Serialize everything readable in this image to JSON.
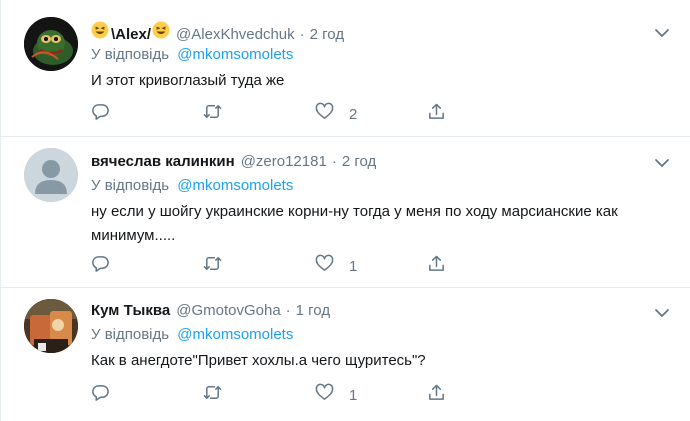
{
  "tweets": [
    {
      "name": "\\Alex/",
      "handle": "@AlexKhvedchuk",
      "dot": "·",
      "time": "2 год",
      "reply_prefix": "У відповідь",
      "reply_mention": "@mkomsomolets",
      "text": "И этот кривоглазый туда же",
      "like_count": "2"
    },
    {
      "name": "вячеслав калинкин",
      "handle": "@zero12181",
      "dot": "·",
      "time": "2 год",
      "reply_prefix": "У відповідь",
      "reply_mention": "@mkomsomolets",
      "text": "ну если у шойгу украинские корни-ну тогда у меня по ходу марсианские как минимум.....",
      "like_count": "1"
    },
    {
      "name": "Кум Тыква",
      "handle": "@GmotovGoha",
      "dot": "·",
      "time": "1 год",
      "reply_prefix": "У відповідь",
      "reply_mention": "@mkomsomolets",
      "text": "Как в анегдоте\"Привет хохлы.а чего щуритесь\"?",
      "like_count": "1"
    }
  ],
  "icons": {
    "reply": "reply-icon",
    "retweet": "retweet-icon",
    "like": "like-icon",
    "share": "share-icon",
    "more": "chevron-down-icon",
    "emoji": "grinning-squinting-face-emoji"
  },
  "colors": {
    "accent": "#1da1f2",
    "secondary_text": "#657786",
    "icon": "#657786",
    "divider": "#e6ecf0"
  }
}
